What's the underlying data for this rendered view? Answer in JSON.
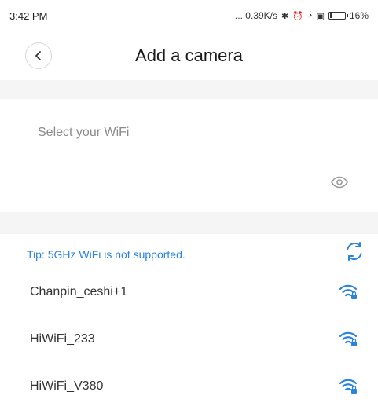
{
  "status_bar": {
    "time": "3:42 PM",
    "network_speed": "... 0.39K/s",
    "battery_percent": "16%",
    "battery_level": 0.16,
    "icons": [
      "bluetooth-icon",
      "alarm-icon",
      "wifi-signal-icon",
      "sim-icon",
      "battery-icon"
    ]
  },
  "header": {
    "title": "Add a camera",
    "back_icon": "chevron-left-icon"
  },
  "wifi_form": {
    "select_label": "Select your WiFi",
    "password_toggle_icon": "eye-icon"
  },
  "tip": {
    "text": "Tip: 5GHz WiFi is not supported.",
    "refresh_icon": "refresh-icon"
  },
  "networks": [
    {
      "name": "Chanpin_ceshi+1",
      "icon": "wifi-lock-icon"
    },
    {
      "name": "HiWiFi_233",
      "icon": "wifi-lock-icon"
    },
    {
      "name": "HiWiFi_V380",
      "icon": "wifi-lock-icon"
    }
  ],
  "colors": {
    "accent": "#2b84d8",
    "background": "#ffffff",
    "band": "#f5f5f5",
    "text": "#333333",
    "muted": "#8a8a8a"
  }
}
